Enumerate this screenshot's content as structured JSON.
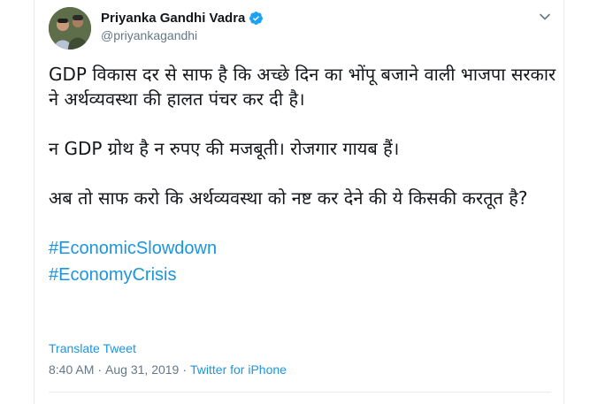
{
  "tweet": {
    "author": {
      "display_name": "Priyanka Gandhi Vadra",
      "handle": "@priyankagandhi",
      "verified": true
    },
    "paragraphs": [
      "GDP विकास दर से साफ है कि अच्छे दिन का भोंपू बजाने वाली भाजपा सरकार ने अर्थव्यवस्था की हालत पंचर कर दी है।",
      "न GDP ग्रोथ है न रुपए की मजबूती। रोजगार गायब हैं।",
      "अब तो साफ करो कि अर्थव्यवस्था को नष्ट कर देने की ये किसकी करतूत है?"
    ],
    "hashtags": [
      "#EconomicSlowdown",
      "#EconomyCrisis"
    ],
    "translate_label": "Translate Tweet",
    "time": "8:40 AM",
    "date": "Aug 31, 2019",
    "separator": "·",
    "source": "Twitter for iPhone"
  },
  "colors": {
    "link": "#1b95e0",
    "muted": "#657786",
    "text": "#14171a",
    "verified": "#1da1f2"
  },
  "icons": {
    "verified": "verified-badge-icon",
    "menu": "chevron-down-icon"
  }
}
